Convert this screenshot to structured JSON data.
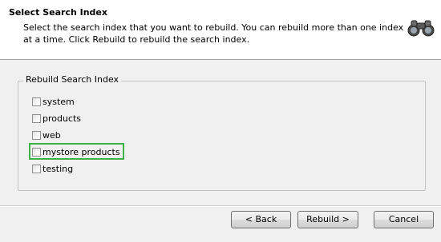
{
  "header": {
    "title": "Select Search Index",
    "description": "Select the search index that you want to rebuild. You can rebuild more than one index at a time. Click Rebuild to rebuild the search index."
  },
  "group": {
    "label": "Rebuild Search Index",
    "items": [
      {
        "label": "system",
        "checked": false
      },
      {
        "label": "products",
        "checked": false
      },
      {
        "label": "web",
        "checked": false
      },
      {
        "label": "mystore products",
        "checked": false,
        "highlighted": true
      },
      {
        "label": "testing",
        "checked": false
      }
    ]
  },
  "buttons": {
    "back": "< Back",
    "rebuild": "Rebuild >",
    "cancel": "Cancel"
  },
  "colors": {
    "highlight": "#3cb247",
    "header_bg": "#ffffff",
    "body_bg": "#f0f0f0"
  }
}
